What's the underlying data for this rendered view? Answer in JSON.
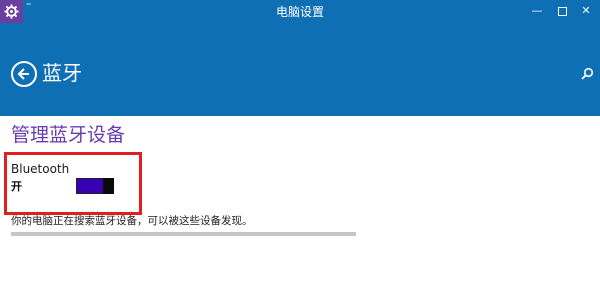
{
  "titlebar": {
    "title": "电脑设置",
    "app_icon": "gear-icon",
    "menu_glyph": "⁼",
    "buttons": [
      "minimize",
      "maximize",
      "close"
    ],
    "close_glyph": "✕",
    "min_glyph": "—"
  },
  "header": {
    "heading": "蓝牙",
    "back_icon": "back-arrow-icon",
    "search_icon": "search-icon"
  },
  "main": {
    "section_title": "管理蓝牙设备",
    "bluetooth": {
      "label": "Bluetooth",
      "state": "开",
      "on": true
    },
    "status": "你的电脑正在搜索蓝牙设备，可以被这些设备发现。"
  },
  "colors": {
    "accent": "#0e6fb4",
    "title_purple": "#6a3ab2",
    "toggle_fill": "#3700b3",
    "highlight": "#e02020"
  }
}
